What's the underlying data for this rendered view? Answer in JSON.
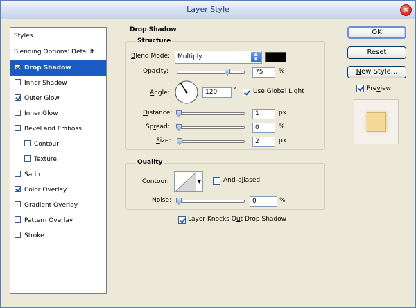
{
  "window": {
    "title": "Layer Style",
    "close_glyph": "×"
  },
  "styles_panel": {
    "header": "Styles",
    "blending": "Blending Options: Default",
    "items": [
      {
        "label": "Drop Shadow",
        "checked": true,
        "selected": true,
        "indent": false
      },
      {
        "label": "Inner Shadow",
        "checked": false,
        "selected": false,
        "indent": false
      },
      {
        "label": "Outer Glow",
        "checked": true,
        "selected": false,
        "indent": false
      },
      {
        "label": "Inner Glow",
        "checked": false,
        "selected": false,
        "indent": false
      },
      {
        "label": "Bevel and Emboss",
        "checked": false,
        "selected": false,
        "indent": false
      },
      {
        "label": "Contour",
        "checked": false,
        "selected": false,
        "indent": true
      },
      {
        "label": "Texture",
        "checked": false,
        "selected": false,
        "indent": true
      },
      {
        "label": "Satin",
        "checked": false,
        "selected": false,
        "indent": false
      },
      {
        "label": "Color Overlay",
        "checked": true,
        "selected": false,
        "indent": false
      },
      {
        "label": "Gradient Overlay",
        "checked": false,
        "selected": false,
        "indent": false
      },
      {
        "label": "Pattern Overlay",
        "checked": false,
        "selected": false,
        "indent": false
      },
      {
        "label": "Stroke",
        "checked": false,
        "selected": false,
        "indent": false
      }
    ]
  },
  "drop_shadow": {
    "title": "Drop Shadow",
    "structure": {
      "title": "Structure",
      "blend_mode_label": "Blend Mode:",
      "blend_mode_value": "Multiply",
      "swatch_color": "#000000",
      "opacity_label": "Opacity:",
      "opacity_value": "75",
      "opacity_unit": "%",
      "opacity_level": 0.75,
      "angle_label": "Angle:",
      "angle_value": "120",
      "angle_unit": "°",
      "use_global_light_label": "Use Global Light",
      "use_global_light_checked": true,
      "distance_label": "Distance:",
      "distance_value": "1",
      "distance_unit": "px",
      "spread_label": "Spread:",
      "spread_value": "0",
      "spread_unit": "%",
      "size_label": "Size:",
      "size_value": "2",
      "size_unit": "px"
    },
    "quality": {
      "title": "Quality",
      "contour_label": "Contour:",
      "anti_aliased_label": "Anti-aliased",
      "anti_aliased_checked": false,
      "noise_label": "Noise:",
      "noise_value": "0",
      "noise_unit": "%"
    },
    "knocks_out_label": "Layer Knocks Out Drop Shadow",
    "knocks_out_checked": true
  },
  "buttons": {
    "ok": "OK",
    "reset": "Reset",
    "new_style": "New Style..."
  },
  "preview": {
    "label": "Preview",
    "checked": true,
    "color": "#f5d99a"
  },
  "colors": {
    "selection": "#1a5bc4",
    "dialog_bg": "#ece9d8"
  }
}
